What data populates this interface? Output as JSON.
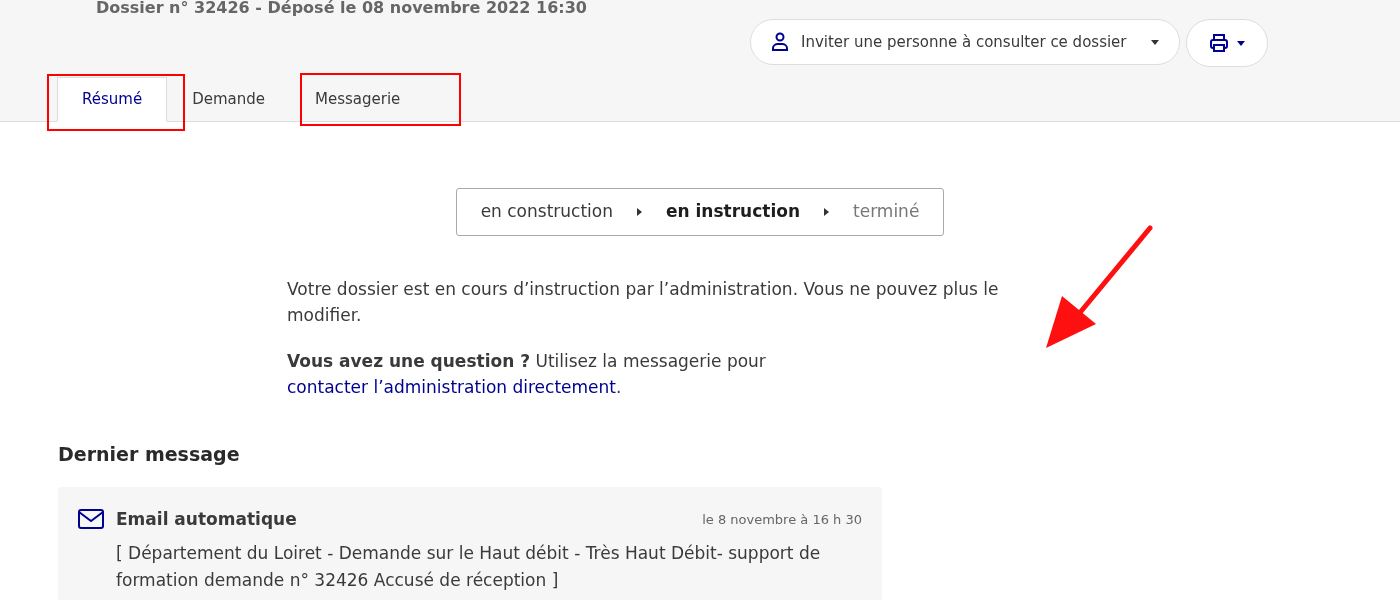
{
  "header": {
    "title": "Dossier n° 32426 - Déposé le 08 novembre 2022 16:30",
    "invite_button": "Inviter une personne à consulter ce dossier"
  },
  "tabs": [
    {
      "label": "Résumé",
      "selected": true
    },
    {
      "label": "Demande",
      "selected": false
    },
    {
      "label": "Messagerie",
      "selected": false
    }
  ],
  "status_steps": [
    {
      "label": "en construction",
      "kind": "past"
    },
    {
      "label": "en instruction",
      "kind": "current"
    },
    {
      "label": "terminé",
      "kind": "future"
    }
  ],
  "info": "Votre dossier est en cours d’instruction par l’administration. Vous ne pouvez plus le modifier.",
  "question": {
    "lead": "**Vous avez une question ?** Utilisez la messagerie pour",
    "link": "contacter l’administration directement",
    "end": "."
  },
  "last_message": {
    "heading": "Dernier message",
    "sender": "Email automatique",
    "date": "le 8 novembre à 16 h 30",
    "body": "[ Département du Loiret - Demande sur le Haut débit - Très Haut Débit- support de formation demande n° 32426 Accusé de réception ]"
  }
}
